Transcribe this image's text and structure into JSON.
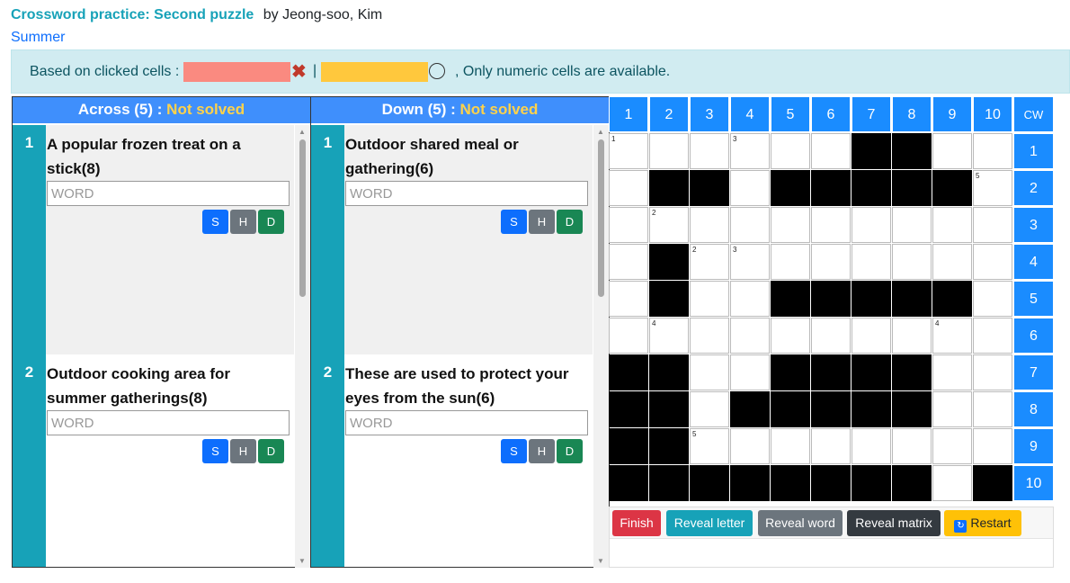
{
  "header": {
    "title": "Crossword practice: Second puzzle",
    "author": "by Jeong-soo, Kim",
    "category": "Summer"
  },
  "info": {
    "label": "Based on clicked cells :",
    "separator": "|",
    "note": ", Only numeric cells are available."
  },
  "across": {
    "title": "Across (5) :",
    "status": "Not solved",
    "clues": [
      {
        "num": "1",
        "text": "A popular frozen treat on a stick(8)",
        "placeholder": "WORD"
      },
      {
        "num": "2",
        "text": "Outdoor cooking area for summer gatherings(8)",
        "placeholder": "WORD"
      }
    ]
  },
  "down": {
    "title": "Down (5) :",
    "status": "Not solved",
    "clues": [
      {
        "num": "1",
        "text": "Outdoor shared meal or gathering(6)",
        "placeholder": "WORD"
      },
      {
        "num": "2",
        "text": "These are used to protect your eyes from the sun(6)",
        "placeholder": "WORD"
      }
    ]
  },
  "buttons_small": {
    "s": "S",
    "h": "H",
    "d": "D"
  },
  "grid": {
    "col_headers": [
      "1",
      "2",
      "3",
      "4",
      "5",
      "6",
      "7",
      "8",
      "9",
      "10"
    ],
    "cw_label": "CW",
    "row_headers": [
      "1",
      "2",
      "3",
      "4",
      "5",
      "6",
      "7",
      "8",
      "9",
      "10"
    ],
    "rows": [
      "......##..",
      ".##.#####.",
      "..........",
      ".#........",
      ".#..#####.",
      "..........",
      "##..####..",
      "##.#####..",
      "##........",
      "########.#"
    ],
    "numbers": [
      {
        "r": 0,
        "c": 0,
        "n": "1"
      },
      {
        "r": 0,
        "c": 3,
        "n": "3"
      },
      {
        "r": 1,
        "c": 9,
        "n": "5"
      },
      {
        "r": 2,
        "c": 1,
        "n": "2"
      },
      {
        "r": 3,
        "c": 2,
        "n": "2"
      },
      {
        "r": 3,
        "c": 3,
        "n": "3"
      },
      {
        "r": 5,
        "c": 1,
        "n": "4"
      },
      {
        "r": 5,
        "c": 8,
        "n": "4"
      },
      {
        "r": 8,
        "c": 2,
        "n": "5"
      }
    ]
  },
  "actions": {
    "finish": "Finish",
    "reveal_letter": "Reveal letter",
    "reveal_word": "Reveal word",
    "reveal_matrix": "Reveal matrix",
    "restart": "Restart"
  },
  "colors": {
    "wrong_swatch": "#fa8a80",
    "hint_swatch": "#ffc83d",
    "header_blue": "#3f8ffc",
    "grid_header_blue": "#1a8cff",
    "clue_number_teal": "#17a2b8"
  }
}
